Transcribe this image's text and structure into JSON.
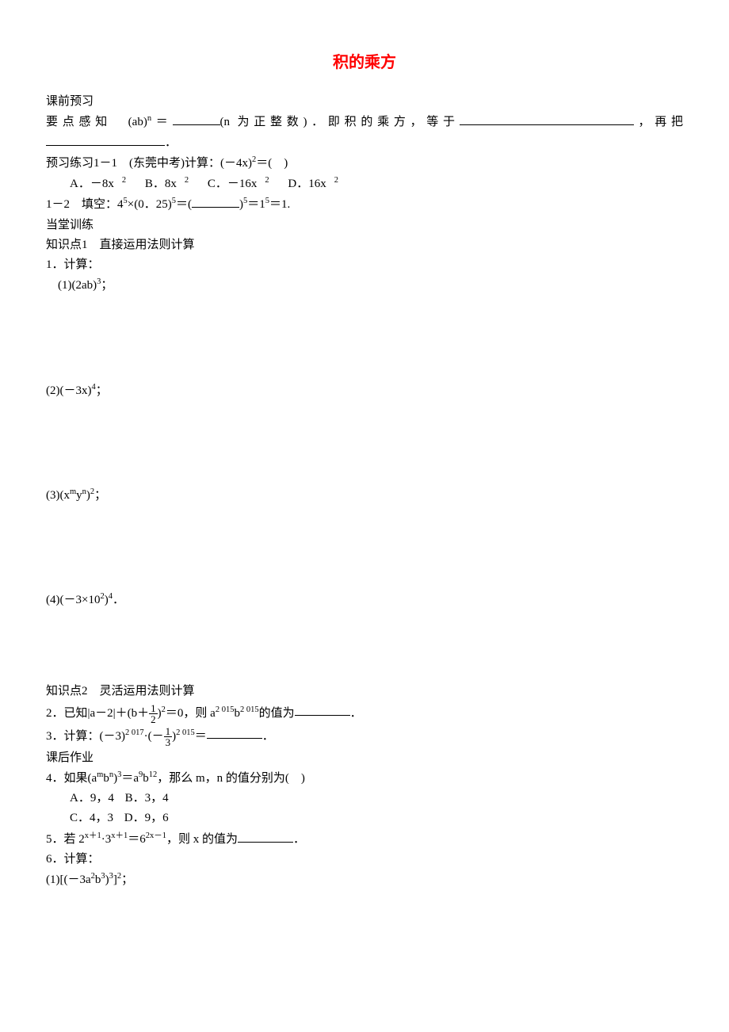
{
  "title": "积的乘方",
  "s1": {
    "h": "课前预习",
    "ydgz_lead": "要点感知　(ab)",
    "ydgz_exp": "n",
    "ydgz_eq": "＝",
    "ydgz_paren_post": "(n 为正整数)．即积的乘方，等于",
    "ydgz_tail": "，再把",
    "ydgz_period": "．",
    "yx11_label": "预习练习1－1　(东莞中考)计算：(－4x)",
    "yx11_exp": "2",
    "yx11_eq": "＝(　)",
    "yx11_opts": {
      "a": "A．－8x",
      "b": "B．8x",
      "c": "C．－16x",
      "d": "D．16x",
      "sq": "2"
    },
    "yx12_lead": "1－2　填空：4",
    "yx12_a": "5",
    "yx12_mul": "×(0．25)",
    "yx12_b": "5",
    "yx12_eq1": "＝(",
    "yx12_close": ")",
    "yx12_c": "5",
    "yx12_eq2": "＝1",
    "yx12_d": "5",
    "yx12_eq3": "＝1."
  },
  "s2": {
    "h": "当堂训练",
    "zsd1": "知识点1　直接运用法则计算",
    "q1": "1．计算：",
    "q1_1": "(1)(2ab)",
    "q1_1e": "3",
    "semi": "；",
    "q1_2": "(2)(－3x)",
    "q1_2e": "4",
    "q1_3a": "(3)(x",
    "q1_3m": "m",
    "q1_3b": "y",
    "q1_3n": "n",
    "q1_3c": ")",
    "q1_3e": "2",
    "q1_4": "(4)(－3×10",
    "q1_4a": "2",
    "q1_4b": ")",
    "q1_4e": "4",
    "period": "．",
    "zsd2": "知识点2　灵活运用法则计算",
    "q2a": "2．已知|a－2|＋(b＋",
    "q2frac_n": "1",
    "q2frac_d": "2",
    "q2b": ")",
    "q2exp": "2",
    "q2c": "＝0，则 a",
    "q2e1": "2 015",
    "q2d": "b",
    "q2e2": "2 015",
    "q2e": "的值为",
    "q3a": "3．计算：(－3)",
    "q3e1": "2 017",
    "q3dot": "·(－",
    "q3frac_n": "1",
    "q3frac_d": "3",
    "q3b": ")",
    "q3e2": "2 015",
    "q3c": "＝"
  },
  "s3": {
    "h": "课后作业",
    "q4a": "4．如果(a",
    "q4m": "m",
    "q4b": "b",
    "q4n": "n",
    "q4c": ")",
    "q4e": "3",
    "q4d": "＝a",
    "q4e9": "9",
    "q4f": "b",
    "q4e12": "12",
    "q4g": "，那么 m，n 的值分别为(　)",
    "q4_opts": {
      "a": "A．9，4",
      "b": "B．3，4",
      "c": "C．4，3",
      "d": "D．9，6"
    },
    "q5a": "5．若 2",
    "q5e1": "x＋1",
    "q5dot": "·3",
    "q5e2": "x＋1",
    "q5b": "＝6",
    "q5e3": "2x－1",
    "q5c": "，则 x 的值为",
    "q6": "6．计算：",
    "q6_1a": "(1)[(－3a",
    "q6_1e1": "2",
    "q6_1b": "b",
    "q6_1e2": "3",
    "q6_1c": ")",
    "q6_1e3": "3",
    "q6_1d": "]",
    "q6_1e4": "2",
    "semi": "；"
  }
}
